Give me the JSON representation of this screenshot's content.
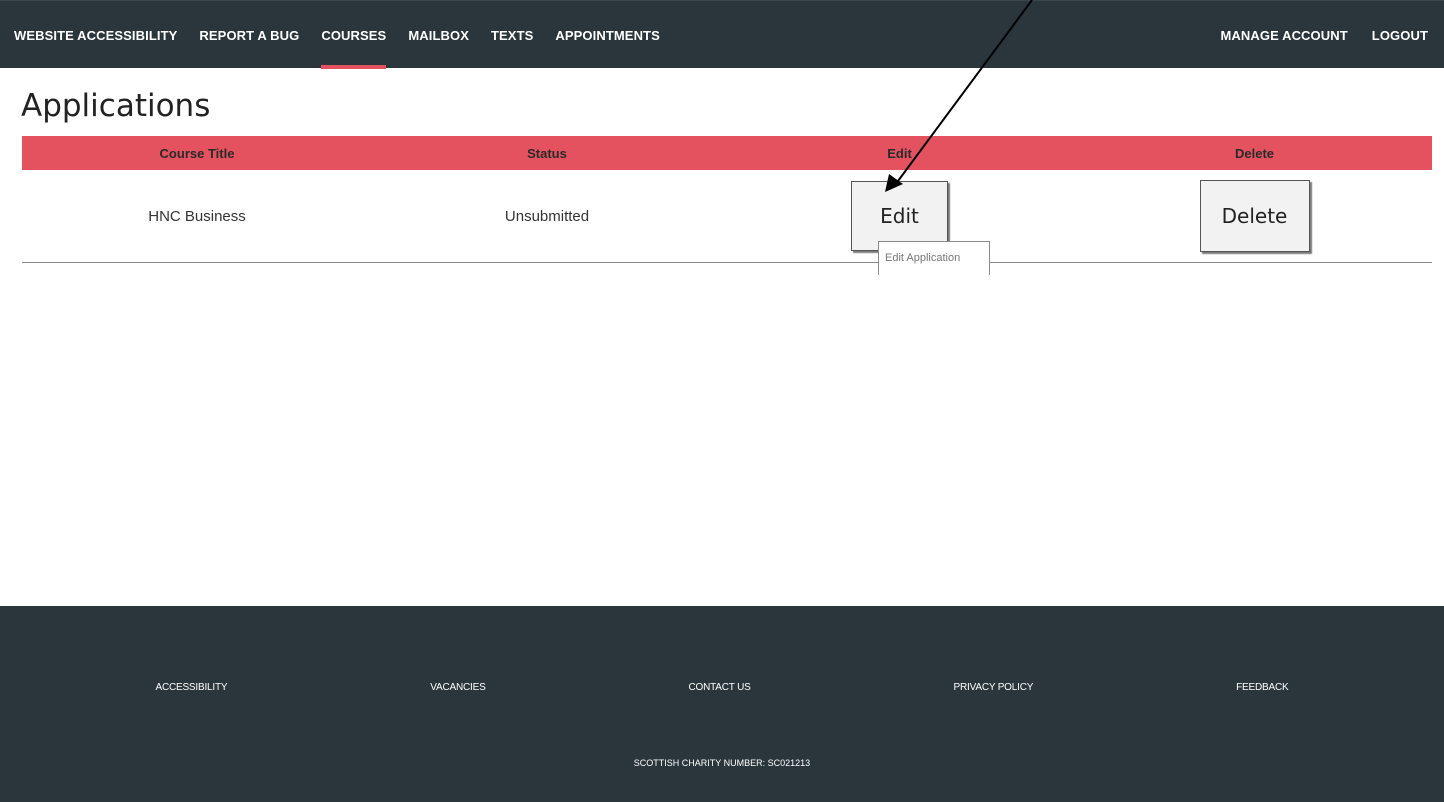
{
  "nav": {
    "left": [
      "WEBSITE ACCESSIBILITY",
      "REPORT A BUG",
      "COURSES",
      "MAILBOX",
      "TEXTS",
      "APPOINTMENTS"
    ],
    "right": [
      "MANAGE ACCOUNT",
      "LOGOUT"
    ],
    "active": "COURSES"
  },
  "page": {
    "title": "Applications"
  },
  "table": {
    "headers": [
      "Course Title",
      "Status",
      "Edit",
      "Delete"
    ],
    "rows": [
      {
        "course_title": "HNC Business",
        "status": "Unsubmitted",
        "edit_label": "Edit",
        "delete_label": "Delete"
      }
    ]
  },
  "tooltip": {
    "text": "Edit Application"
  },
  "footer": {
    "links": [
      "ACCESSIBILITY",
      "VACANCIES",
      "CONTACT US",
      "PRIVACY POLICY",
      "FEEDBACK"
    ],
    "charity": "SCOTTISH CHARITY NUMBER: SC021213"
  },
  "colors": {
    "nav_bg": "#2a363b",
    "accent": "#e4525f",
    "footer_bg": "#2a363b"
  }
}
